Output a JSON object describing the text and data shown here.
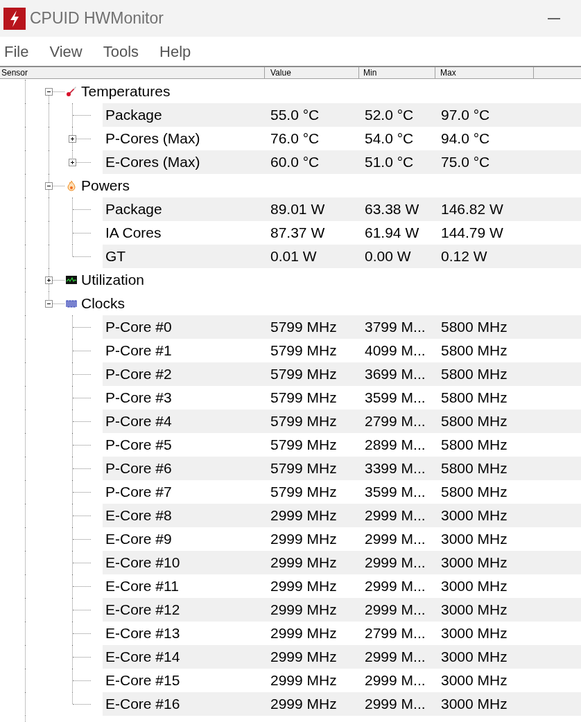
{
  "window": {
    "title": "CPUID HWMonitor"
  },
  "menu": [
    "File",
    "View",
    "Tools",
    "Help"
  ],
  "columns": [
    "Sensor",
    "Value",
    "Min",
    "Max"
  ],
  "groups": [
    {
      "name": "Temperatures",
      "kind": "temperature",
      "expanded": true,
      "children": [
        {
          "name": "Package",
          "value": "55.0 °C",
          "min": "52.0 °C",
          "max": "97.0 °C"
        },
        {
          "name": "P-Cores (Max)",
          "expanded": false,
          "value": "76.0 °C",
          "min": "54.0 °C",
          "max": "94.0 °C"
        },
        {
          "name": "E-Cores (Max)",
          "expanded": false,
          "value": "60.0 °C",
          "min": "51.0 °C",
          "max": "75.0 °C"
        }
      ]
    },
    {
      "name": "Powers",
      "kind": "power",
      "expanded": true,
      "children": [
        {
          "name": "Package",
          "value": "89.01 W",
          "min": "63.38 W",
          "max": "146.82 W"
        },
        {
          "name": "IA Cores",
          "value": "87.37 W",
          "min": "61.94 W",
          "max": "144.79 W"
        },
        {
          "name": "GT",
          "value": "0.01 W",
          "min": "0.00 W",
          "max": "0.12 W"
        }
      ]
    },
    {
      "name": "Utilization",
      "kind": "utilization",
      "expanded": false
    },
    {
      "name": "Clocks",
      "kind": "clock",
      "expanded": true,
      "children": [
        {
          "name": "P-Core #0",
          "value": "5799 MHz",
          "min": "3799 M...",
          "max": "5800 MHz"
        },
        {
          "name": "P-Core #1",
          "value": "5799 MHz",
          "min": "4099 M...",
          "max": "5800 MHz"
        },
        {
          "name": "P-Core #2",
          "value": "5799 MHz",
          "min": "3699 M...",
          "max": "5800 MHz"
        },
        {
          "name": "P-Core #3",
          "value": "5799 MHz",
          "min": "3599 M...",
          "max": "5800 MHz"
        },
        {
          "name": "P-Core #4",
          "value": "5799 MHz",
          "min": "2799 M...",
          "max": "5800 MHz"
        },
        {
          "name": "P-Core #5",
          "value": "5799 MHz",
          "min": "2899 M...",
          "max": "5800 MHz"
        },
        {
          "name": "P-Core #6",
          "value": "5799 MHz",
          "min": "3399 M...",
          "max": "5800 MHz"
        },
        {
          "name": "P-Core #7",
          "value": "5799 MHz",
          "min": "3599 M...",
          "max": "5800 MHz"
        },
        {
          "name": "E-Core #8",
          "value": "2999 MHz",
          "min": "2999 M...",
          "max": "3000 MHz"
        },
        {
          "name": "E-Core #9",
          "value": "2999 MHz",
          "min": "2999 M...",
          "max": "3000 MHz"
        },
        {
          "name": "E-Core #10",
          "value": "2999 MHz",
          "min": "2999 M...",
          "max": "3000 MHz"
        },
        {
          "name": "E-Core #11",
          "value": "2999 MHz",
          "min": "2999 M...",
          "max": "3000 MHz"
        },
        {
          "name": "E-Core #12",
          "value": "2999 MHz",
          "min": "2999 M...",
          "max": "3000 MHz"
        },
        {
          "name": "E-Core #13",
          "value": "2999 MHz",
          "min": "2799 M...",
          "max": "3000 MHz"
        },
        {
          "name": "E-Core #14",
          "value": "2999 MHz",
          "min": "2999 M...",
          "max": "3000 MHz"
        },
        {
          "name": "E-Core #15",
          "value": "2999 MHz",
          "min": "2999 M...",
          "max": "3000 MHz"
        },
        {
          "name": "E-Core #16",
          "value": "2999 MHz",
          "min": "2999 M...",
          "max": "3000 MHz"
        }
      ]
    }
  ]
}
